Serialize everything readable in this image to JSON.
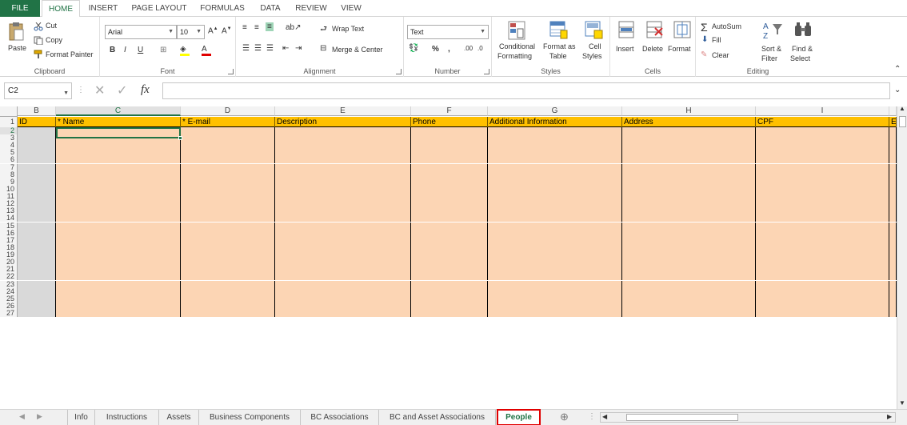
{
  "menu": {
    "file": "FILE",
    "tabs": [
      "HOME",
      "INSERT",
      "PAGE LAYOUT",
      "FORMULAS",
      "DATA",
      "REVIEW",
      "VIEW"
    ]
  },
  "ribbon": {
    "clipboard": {
      "label": "Clipboard",
      "paste": "Paste",
      "cut": "Cut",
      "copy": "Copy",
      "format_painter": "Format Painter"
    },
    "font": {
      "label": "Font",
      "name": "Arial",
      "size": "10"
    },
    "alignment": {
      "label": "Alignment",
      "wrap_text": "Wrap Text",
      "merge_center": "Merge & Center"
    },
    "number": {
      "label": "Number",
      "format": "Text",
      "percent": "%",
      "comma": ","
    },
    "styles": {
      "label": "Styles",
      "conditional_1": "Conditional",
      "conditional_2": "Formatting",
      "format_as_1": "Format as",
      "format_as_2": "Table",
      "cell_styles_1": "Cell",
      "cell_styles_2": "Styles"
    },
    "cells": {
      "label": "Cells",
      "insert": "Insert",
      "delete": "Delete",
      "format": "Format"
    },
    "editing": {
      "label": "Editing",
      "autosum": "AutoSum",
      "fill": "Fill",
      "clear": "Clear",
      "sort_1": "Sort &",
      "sort_2": "Filter",
      "find_1": "Find &",
      "find_2": "Select"
    }
  },
  "formula_bar": {
    "name_box": "C2",
    "fx": "fx",
    "value": ""
  },
  "columns": [
    "B",
    "C",
    "D",
    "E",
    "F",
    "G",
    "H",
    "I"
  ],
  "header_row": {
    "row_number": "1",
    "cells": [
      "ID",
      "* Name",
      "* E-mail",
      "Description",
      "Phone",
      "Additional Information",
      "Address",
      "CPF",
      "E"
    ]
  },
  "row_numbers": [
    "2",
    "3",
    "4",
    "5",
    "6",
    "7",
    "8",
    "9",
    "10",
    "11",
    "12",
    "13",
    "14",
    "15",
    "16",
    "17",
    "18",
    "19",
    "20",
    "21",
    "22",
    "23",
    "24",
    "25",
    "26",
    "27"
  ],
  "sheet_tabs": [
    "Info",
    "Instructions",
    "Assets",
    "Business Components",
    "BC Associations",
    "BC and Asset Associations",
    "People"
  ],
  "active_sheet": "People",
  "colors": {
    "accent": "#217346",
    "header_fill": "#ffc000",
    "data_fill": "#fcd5b4",
    "id_fill": "#d9d9d9",
    "tab_highlight": "#e00000"
  }
}
